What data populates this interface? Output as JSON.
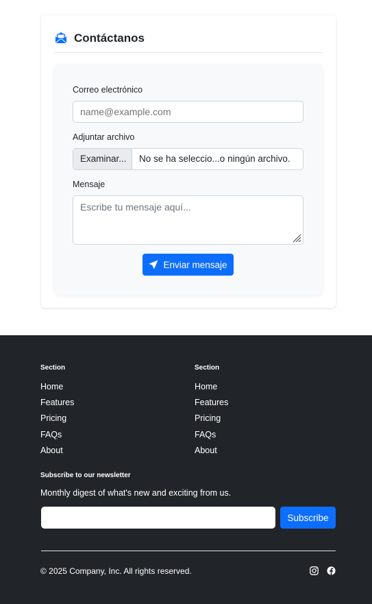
{
  "contact": {
    "title": "Contáctanos",
    "email_label": "Correo electrónico",
    "email_placeholder": "name@example.com",
    "file_label": "Adjuntar archivo",
    "file_button": "Examinar...",
    "file_status": "No se ha seleccio...o ningún archivo.",
    "message_label": "Mensaje",
    "message_placeholder": "Escribe tu mensaje aquí...",
    "send_label": "Enviar mensaje",
    "accent_color": "#0d6efd"
  },
  "footer": {
    "columns": [
      {
        "heading": "Section",
        "links": [
          "Home",
          "Features",
          "Pricing",
          "FAQs",
          "About"
        ]
      },
      {
        "heading": "Section",
        "links": [
          "Home",
          "Features",
          "Pricing",
          "FAQs",
          "About"
        ]
      }
    ],
    "newsletter": {
      "heading": "Subscribe to our newsletter",
      "description": "Monthly digest of what's new and exciting from us.",
      "button": "Subscribe"
    },
    "copyright": "© 2025 Company, Inc. All rights reserved.",
    "social_icons": [
      "instagram-icon",
      "facebook-icon"
    ],
    "background_color": "#212529"
  }
}
